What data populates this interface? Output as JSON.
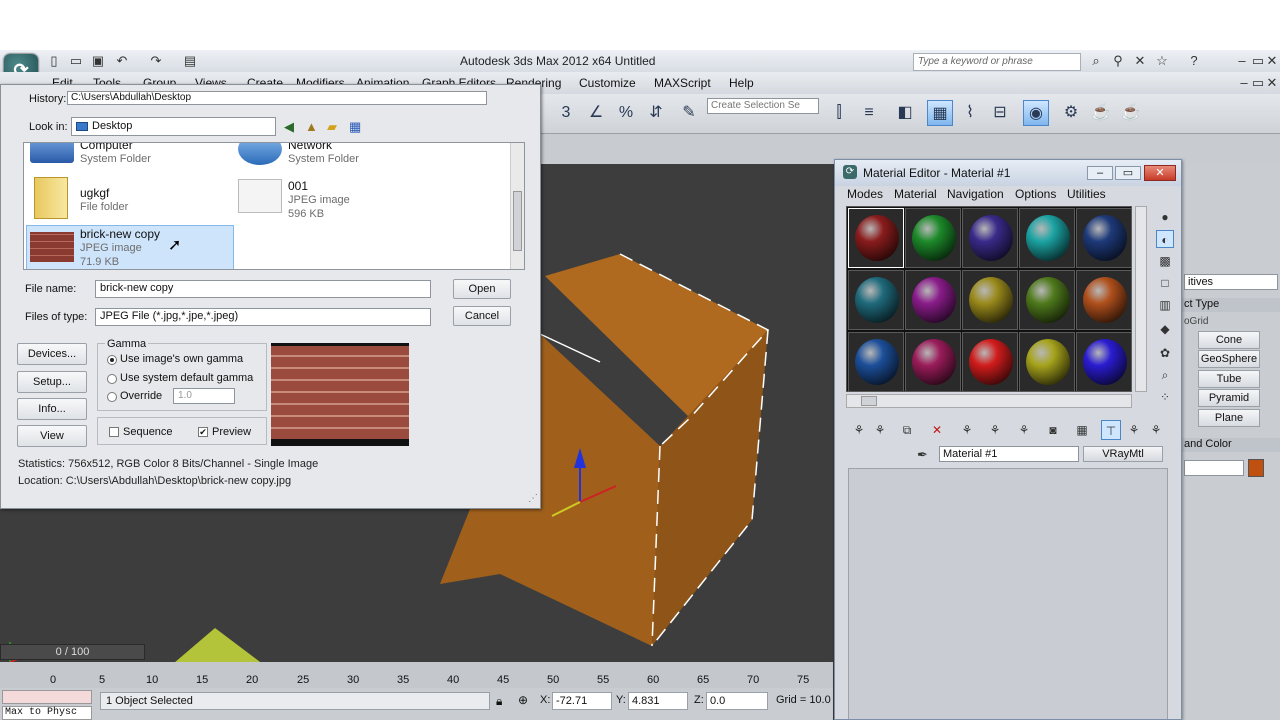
{
  "titlebar": {
    "title": "Autodesk 3ds Max  2012 x64      Untitled",
    "search_placeholder": "Type a keyword or phrase"
  },
  "menu": [
    "Edit",
    "Tools",
    "Group",
    "Views",
    "Create",
    "Modifiers",
    "Animation",
    "Graph Editors",
    "Rendering",
    "Customize",
    "MAXScript",
    "Help"
  ],
  "toolbar": {
    "selection_set_placeholder": "Create Selection Se"
  },
  "dialog": {
    "history_label": "History:",
    "history_value": "C:\\Users\\Abdullah\\Desktop",
    "look_in_label": "Look in:",
    "look_in_value": "Desktop",
    "files": [
      {
        "name": "Computer",
        "type": "System Folder"
      },
      {
        "name": "Network",
        "type": "System Folder"
      },
      {
        "name": "ugkgf",
        "type": "File folder"
      },
      {
        "name": "001",
        "type": "JPEG image",
        "size": "596 KB"
      },
      {
        "name": "brick-new copy",
        "type": "JPEG image",
        "size": "71.9 KB"
      }
    ],
    "file_name_label": "File name:",
    "file_name_value": "brick-new copy",
    "files_of_type_label": "Files of type:",
    "files_of_type_value": "JPEG File (*.jpg,*.jpe,*.jpeg)",
    "open_label": "Open",
    "cancel_label": "Cancel",
    "devices_label": "Devices...",
    "setup_label": "Setup...",
    "info_label": "Info...",
    "view_label": "View",
    "gamma_title": "Gamma",
    "gamma_options": [
      "Use image's own gamma",
      "Use system default gamma",
      "Override"
    ],
    "override_value": "1.0",
    "sequence_label": "Sequence",
    "preview_label": "Preview",
    "statistics": "Statistics:  756x512, RGB Color 8 Bits/Channel - Single Image",
    "location": "Location:   C:\\Users\\Abdullah\\Desktop\\brick-new copy.jpg"
  },
  "material_editor": {
    "title": "Material Editor - Material #1",
    "menu": [
      "Modes",
      "Material",
      "Navigation",
      "Options",
      "Utilities"
    ],
    "material_name": "Material #1",
    "material_type": "VRayMtl",
    "sphere_colors": [
      "#8a1c1c",
      "#1d8a2a",
      "#3a2a8a",
      "#1ca3a3",
      "#1e3a7a",
      "#1f6a7c",
      "#8a1c8a",
      "#9a8a1c",
      "#4f7a1c",
      "#b0501c",
      "#1c4f9a",
      "#9a1c5a",
      "#d11c1c",
      "#a6a31c",
      "#2a1cd1"
    ]
  },
  "command_panel": {
    "dropdown": "itives",
    "object_type": "ct Type",
    "autogrid": "oGrid",
    "buttons": [
      "Cone",
      "GeoSphere",
      "Tube",
      "Pyramid",
      "Plane"
    ],
    "name_color": "and Color"
  },
  "timeline": {
    "frame": "0 / 100",
    "ticks": [
      "0",
      "5",
      "10",
      "15",
      "20",
      "25",
      "30",
      "35",
      "40",
      "45",
      "50",
      "55",
      "60",
      "65",
      "70",
      "75"
    ]
  },
  "status": {
    "script_listener": "Max to Physc",
    "selection": "1 Object Selected",
    "x_label": "X:",
    "x_value": "-72.71",
    "y_label": "Y:",
    "y_value": "4.831",
    "z_label": "Z:",
    "z_value": "0.0",
    "grid": "Grid = 10.0"
  }
}
